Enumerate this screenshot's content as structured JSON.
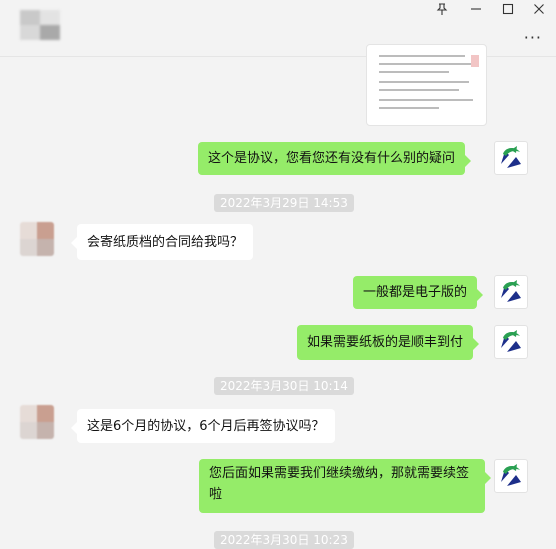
{
  "window": {
    "pin_icon": "pin-icon",
    "minimize_icon": "minimize-icon",
    "maximize_icon": "maximize-icon",
    "close_icon": "close-icon",
    "more_icon": "more-icon",
    "pin_glyph": "―",
    "minimize_glyph": "—",
    "maximize_glyph": "□",
    "close_glyph": "✕",
    "more_glyph": "···"
  },
  "colors": {
    "self_bubble": "#95ec69",
    "other_bubble": "#ffffff",
    "background": "#f3f3f3",
    "timestamp_bg": "#dadada"
  },
  "messages": [
    {
      "from": "self",
      "text": "这个是协议，您看您还有没有什么别的疑问"
    },
    {
      "time": "2022年3月29日 14:53"
    },
    {
      "from": "other",
      "text": "会寄纸质档的合同给我吗？"
    },
    {
      "from": "self",
      "text": "一般都是电子版的"
    },
    {
      "from": "self",
      "text": "如果需要纸板的是顺丰到付"
    },
    {
      "time": "2022年3月30日 10:14"
    },
    {
      "from": "other",
      "text": "这是6个月的协议，6个月后再签协议吗？"
    },
    {
      "from": "self",
      "text": "您后面如果需要我们继续缴纳，那就需要续签啦"
    },
    {
      "time": "2022年3月30日 10:23"
    }
  ]
}
